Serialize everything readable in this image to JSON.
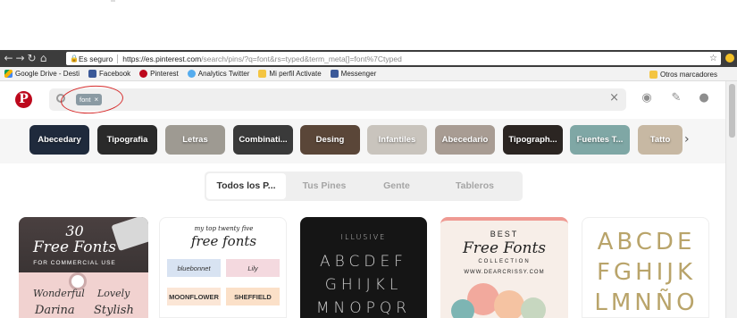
{
  "browser": {
    "secure_label": "Es seguro",
    "url_domain": "https://es.pinterest.com",
    "url_path": "/search/pins/?q=font&rs=typed&term_meta[]=font%7Ctyped"
  },
  "bookmarks": {
    "items": [
      {
        "label": "Google Drive - Desti",
        "icon": "gdrive-icon"
      },
      {
        "label": "Facebook",
        "icon": "facebook-icon"
      },
      {
        "label": "Pinterest",
        "icon": "pinterest-icon"
      },
      {
        "label": "Analytics Twitter",
        "icon": "twitter-icon"
      },
      {
        "label": "Mi perfil Activate",
        "icon": "folder-icon"
      },
      {
        "label": "Messenger",
        "icon": "facebook-icon"
      }
    ],
    "other": "Otros marcadores"
  },
  "pinterest": {
    "logo": "P",
    "search_token": "font",
    "token_remove": "×",
    "clear": "×"
  },
  "guides": [
    {
      "label": "Abecedary",
      "bg": "#1f2a3c"
    },
    {
      "label": "Tipografia",
      "bg": "#2a2a2a"
    },
    {
      "label": "Letras",
      "bg": "#9e9a92"
    },
    {
      "label": "Combinati...",
      "bg": "#3a3a3a"
    },
    {
      "label": "Desing",
      "bg": "#5a4638"
    },
    {
      "label": "Infantiles",
      "bg": "#c9c4bd"
    },
    {
      "label": "Abecedario",
      "bg": "#a89c93"
    },
    {
      "label": "Tipograph...",
      "bg": "#2b2522"
    },
    {
      "label": "Fuentes T...",
      "bg": "#7fa7a5"
    },
    {
      "label": "Tatto",
      "bg": "#c7b8a3"
    }
  ],
  "tabs": [
    {
      "label": "Todos los P...",
      "active": true
    },
    {
      "label": "Tus Pines",
      "active": false
    },
    {
      "label": "Gente",
      "active": false
    },
    {
      "label": "Tableros",
      "active": false
    }
  ],
  "pins": {
    "card1": {
      "num": "30",
      "title": "Free Fonts",
      "sub": "FOR COMMERCIAL USE",
      "w1": "Wonderful",
      "w2": "Lovely",
      "w3": "Darina",
      "w4": "Stylish"
    },
    "card2": {
      "top": "my top twenty five",
      "title": "free fonts",
      "b1": "bluebonnet",
      "b2": "Lily",
      "b3": "MOONFLOWER",
      "b4": "SHEFFIELD"
    },
    "card3": {
      "brand": "ILLUSIVE",
      "row1": "ABCDEF",
      "row2": "GHIJKL",
      "row3": "MNOPQR"
    },
    "card4": {
      "best": "BEST",
      "title": "Free Fonts",
      "collection": "COLLECTION",
      "site": "WWW.DEARCRISSY.COM"
    },
    "card5": {
      "row1": "ABCDE",
      "row2": "FGHIJK",
      "row3": "LMNÑO"
    }
  }
}
